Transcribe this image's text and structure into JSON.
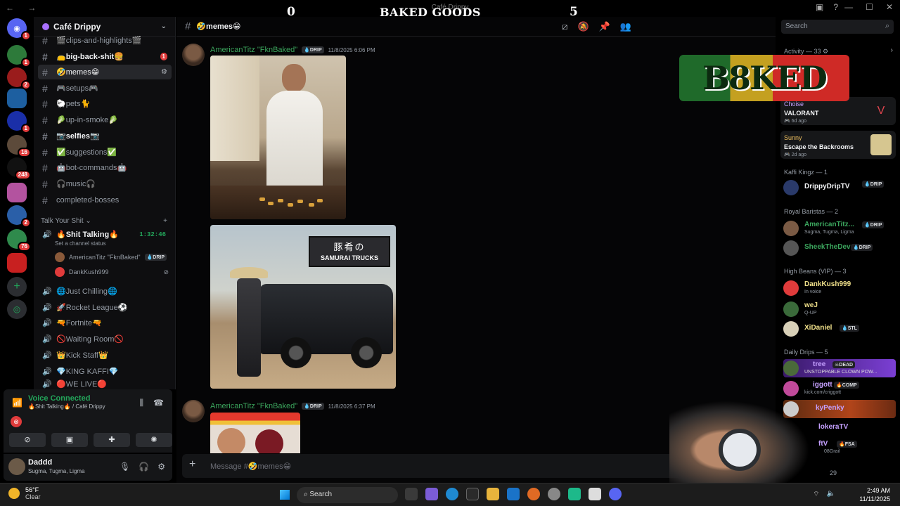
{
  "overlay": {
    "score_left": "0",
    "title": "BAKED GOODS",
    "score_right": "5",
    "logo": "B8KED"
  },
  "window": {
    "title": "Café Drippy",
    "nav": "← →",
    "controls": [
      "—",
      "☐",
      "✕"
    ]
  },
  "rail": {
    "servers": [
      {
        "icon": "discord-icon",
        "badge": "1"
      },
      {
        "icon": "server-pepe",
        "badge": "1"
      },
      {
        "icon": "server-red",
        "badge": "2"
      },
      {
        "icon": "server-blue",
        "badge": ""
      },
      {
        "icon": "server-ps",
        "badge": "1"
      },
      {
        "icon": "server-face",
        "badge": "16"
      },
      {
        "icon": "server-skull",
        "badge": "248"
      },
      {
        "icon": "server-gaming",
        "badge": ""
      },
      {
        "icon": "server-jet",
        "badge": "2"
      },
      {
        "icon": "server-clan",
        "badge": "76"
      },
      {
        "icon": "server-red2",
        "badge": ""
      }
    ]
  },
  "server": {
    "name": "Café Drippy"
  },
  "channels": {
    "text": [
      {
        "name": "🎬clips-and-highlights🎬",
        "state": "normal"
      },
      {
        "name": "👝big-back-shit🍔",
        "state": "unread",
        "mention": "1"
      },
      {
        "name": "🤣memes😁",
        "state": "active"
      },
      {
        "name": "🎮setups🎮",
        "state": "normal"
      },
      {
        "name": "🐑pets🐈",
        "state": "normal"
      },
      {
        "name": "🥬up-in-smoke🥬",
        "state": "normal"
      },
      {
        "name": "📷selfies📷",
        "state": "unread"
      },
      {
        "name": "✅suggestions✅",
        "state": "normal"
      },
      {
        "name": "🤖bot-commands🤖",
        "state": "normal"
      },
      {
        "name": "🎧music🎧",
        "state": "normal"
      },
      {
        "name": "completed-bosses",
        "state": "normal"
      }
    ],
    "category": "Talk Your Shit",
    "voice_active": {
      "name": "🔥Shit Talking🔥",
      "timer": "1:32:46",
      "status": "Set a channel status",
      "users": [
        {
          "name": "AmericanTitz \"FknBaked\"",
          "tag": "💧DRIP"
        },
        {
          "name": "DankKush999",
          "tag": ""
        }
      ]
    },
    "voice": [
      "🌐Just Chilling🌐",
      "🚀Rocket League⚽",
      "🔫Fortnite🔫",
      "🚫Waiting Room🚫",
      "👑Kick Staff👑",
      "💎KING KAFFI💎",
      "🔴WE LIVE🔴"
    ]
  },
  "voice_panel": {
    "title": "Voice Connected",
    "subtitle": "🔥Shit Talking🔥 / Café Drippy"
  },
  "user": {
    "name": "Daddd",
    "status": "Sugma, Tugma, Ligma"
  },
  "chat": {
    "channel": "🤣memes😁",
    "search_placeholder": "Search",
    "messages": [
      {
        "author": "AmericanTitz \"FknBaked\"",
        "tag": "💧DRIP",
        "time": "11/8/2025 6:06 PM",
        "sign_jp": "豚肴の",
        "sign_en": "SAMURAI TRUCKS"
      },
      {
        "author": "AmericanTitz \"FknBaked\"",
        "tag": "💧DRIP",
        "time": "11/8/2025 6:37 PM"
      }
    ],
    "composer_placeholder": "Message #🤣memes😁"
  },
  "members": {
    "activity_header": "Activity — 33 ⚙",
    "activities": [
      {
        "user": "Choise",
        "game": "VALORANT",
        "ago": "🎮 6d ago"
      },
      {
        "user": "Sunny",
        "game": "Escape the Backrooms",
        "ago": "🎮 2d ago"
      }
    ],
    "groups": [
      {
        "header": "Kaffi Kingz — 1",
        "members": [
          {
            "name": "DrippyDripTV",
            "sub": "",
            "tag": "💧DRIP",
            "color": "#f2f3f5"
          }
        ]
      },
      {
        "header": "Royal Baristas — 2",
        "members": [
          {
            "name": "AmericanTitz...",
            "sub": "Sugma, Tugma, Ligma",
            "tag": "💧DRIP",
            "color": "#3ba55d"
          },
          {
            "name": "SheekTheDev",
            "sub": "",
            "tag": "💧DRIP",
            "color": "#3ba55d"
          }
        ]
      },
      {
        "header": "High Beans (VIP) — 3",
        "members": [
          {
            "name": "DankKush999",
            "sub": "In voice",
            "tag": "",
            "color": "#f0e08a"
          },
          {
            "name": "weJ",
            "sub": "Q-UP",
            "tag": "",
            "color": "#f0e08a"
          },
          {
            "name": "XiDaniel",
            "sub": "",
            "tag": "💧STL",
            "color": "#f0e08a"
          }
        ]
      },
      {
        "header": "Daily Drips — 5",
        "members": [
          {
            "name": "tree",
            "sub": "UNSTOPPABLE CLOWN POW...",
            "tag": "☠DEAD",
            "color": "#f2f3f5"
          },
          {
            "name": "iggott",
            "sub": "kick.com/criggott",
            "tag": "🔥COMP",
            "color": "#f2f3f5"
          },
          {
            "name": "kyPenky",
            "sub": "",
            "tag": "",
            "color": "#c5a0ff"
          },
          {
            "name": "lokeraTV",
            "sub": "",
            "tag": "",
            "color": "#c5a0ff"
          },
          {
            "name": "ftV",
            "sub": "08Grail",
            "tag": "🔥FSA",
            "color": "#c5a0ff"
          }
        ]
      }
    ],
    "offline_hint": "29"
  },
  "taskbar": {
    "temp": "56°F",
    "weather": "Clear",
    "search": "Search",
    "time": "2:49 AM",
    "date": "11/11/2025"
  }
}
